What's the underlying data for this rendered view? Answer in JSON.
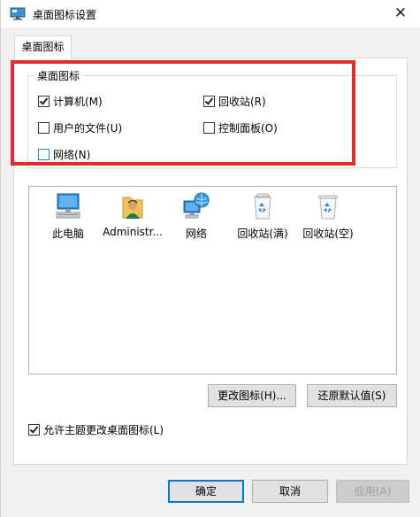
{
  "window": {
    "title": "桌面图标设置",
    "close_symbol": "✕"
  },
  "tabs": [
    {
      "label": "桌面图标"
    }
  ],
  "group": {
    "label": "桌面图标",
    "checkboxes": [
      {
        "label": "计算机(M)",
        "checked": true
      },
      {
        "label": "回收站(R)",
        "checked": true
      },
      {
        "label": "用户的文件(U)",
        "checked": false
      },
      {
        "label": "控制面板(O)",
        "checked": false
      },
      {
        "label": "网络(N)",
        "checked": false
      }
    ]
  },
  "icons": [
    {
      "label": "此电脑",
      "icon": "computer-icon"
    },
    {
      "label": "Administr...",
      "icon": "user-folder-icon"
    },
    {
      "label": "网络",
      "icon": "network-icon"
    },
    {
      "label": "回收站(满)",
      "icon": "recycle-bin-full-icon"
    },
    {
      "label": "回收站(空)",
      "icon": "recycle-bin-empty-icon"
    }
  ],
  "buttons": {
    "change_icon": "更改图标(H)...",
    "restore_default": "还原默认值(S)",
    "ok": "确定",
    "cancel": "取消",
    "apply": "应用(A)"
  },
  "allow_themes": {
    "label": "允许主题更改桌面图标(L)",
    "checked": true
  },
  "colors": {
    "highlight": "#e8282b",
    "accent": "#0078d7"
  }
}
